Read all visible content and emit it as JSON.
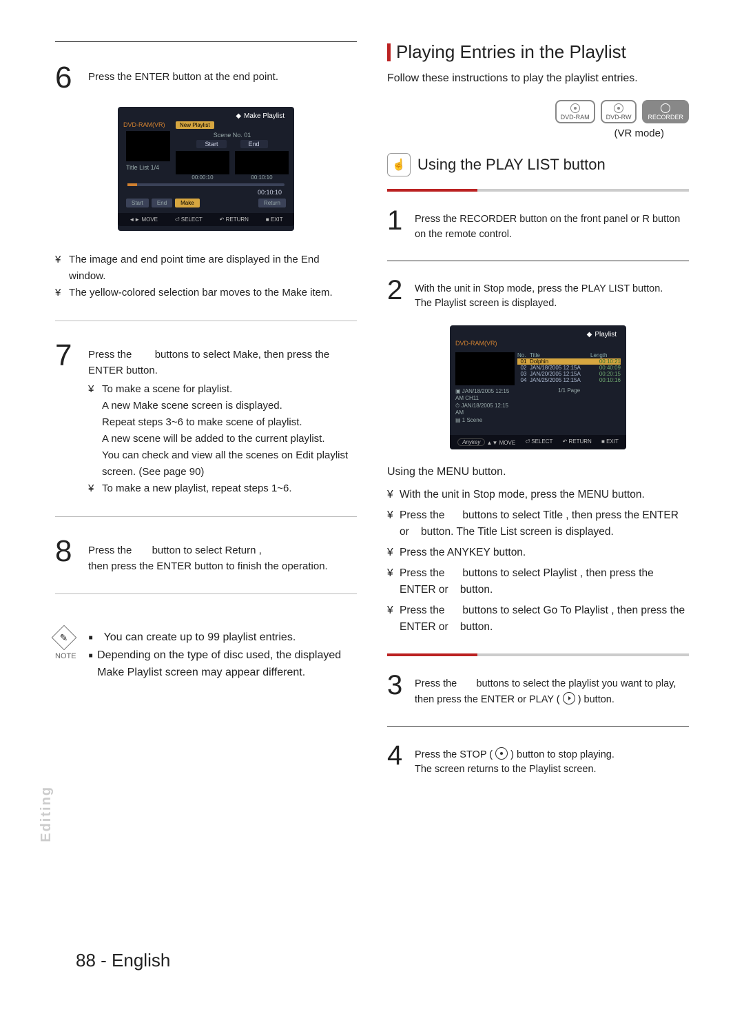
{
  "section_tab": "Editing",
  "page_footer": "88 - English",
  "left": {
    "step6": {
      "num": "6",
      "text": "Press the ENTER button at the end point."
    },
    "screenshot1": {
      "header": "Make Playlist",
      "dvd": "DVD-RAM(VR)",
      "tab": "New Playlist",
      "scene": "Scene No. 01",
      "start_lbl": "Start",
      "end_lbl": "End",
      "title_list": "Title List 1/4",
      "time1": "00:00:10",
      "time2": "00:10:10",
      "total": "00:10:10",
      "btn_start": "Start",
      "btn_end": "End",
      "btn_make": "Make",
      "btn_return": "Return",
      "foot_move": "MOVE",
      "foot_select": "SELECT",
      "foot_return": "RETURN",
      "foot_exit": "EXIT"
    },
    "after6_b1": "The image and end point time are displayed in the End window.",
    "after6_b2": "The yellow-colored selection bar moves to the Make item.",
    "step7": {
      "num": "7",
      "text_a": "Press the",
      "text_b": "buttons to select Make, then press the ENTER button.",
      "sub1": "To make a scene for playlist.",
      "sub1a": "A new Make scene screen is displayed.",
      "sub1b": "Repeat steps 3~6 to make scene of playlist.",
      "sub1c": "A new scene will be added to the current playlist.",
      "sub1d": "You can check and view all the scenes on Edit playlist screen. (See page 90)",
      "sub2": "To make a new playlist, repeat steps 1~6."
    },
    "step8": {
      "num": "8",
      "text_a": "Press the",
      "text_b": "button to select Return ,",
      "text_c": "then press the ENTER button to finish the operation."
    },
    "note": {
      "label": "NOTE",
      "l1": "You can create up to 99 playlist entries.",
      "l2": "Depending on the type of disc used, the displayed Make Playlist screen may appear different."
    }
  },
  "right": {
    "h2": "Playing Entries in the Playlist",
    "lead": "Follow these instructions to play the playlist entries.",
    "badges": {
      "a": "DVD-RAM",
      "b": "DVD-RW",
      "c": "RECORDER"
    },
    "vrmode": "(VR mode)",
    "sub_h": "Using the PLAY LIST button",
    "step1": {
      "num": "1",
      "text": "Press the RECORDER button on the front panel or R button on the remote control."
    },
    "step2": {
      "num": "2",
      "text_a": "With the unit in Stop mode, press the PLAY LIST button.",
      "text_b": "The Playlist screen is displayed."
    },
    "screenshot2": {
      "header": "Playlist",
      "dvd": "DVD-RAM(VR)",
      "th_no": "No.",
      "th_title": "Title",
      "th_len": "Length",
      "rows": [
        {
          "n": "01",
          "t": "Dolphin",
          "l": "00:10:21"
        },
        {
          "n": "02",
          "t": "JAN/18/2005 12:15A",
          "l": "00:40:09"
        },
        {
          "n": "03",
          "t": "JAN/20/2005 12:15A",
          "l": "00:20:15"
        },
        {
          "n": "04",
          "t": "JAN/25/2005 12:15A",
          "l": "00:10:16"
        }
      ],
      "info1": "JAN/18/2005 12:15 AM CH11",
      "info2": "JAN/18/2005 12:15 AM",
      "info3": "1 Scene",
      "page": "1/1  Page",
      "foot_move": "MOVE",
      "foot_select": "SELECT",
      "foot_return": "RETURN",
      "foot_exit": "EXIT"
    },
    "menu_label": "Using the MENU button.",
    "mb1": "With the unit in Stop mode, press the MENU button.",
    "mb2a": "Press the",
    "mb2b": "buttons to select Title , then press the ENTER or",
    "mb2c": "button. The Title List screen is displayed.",
    "mb3": "Press the ANYKEY button.",
    "mb4a": "Press the",
    "mb4b": "buttons to select Playlist , then press the ENTER or",
    "mb4c": "button.",
    "mb5a": "Press the",
    "mb5b": "buttons to select Go To Playlist , then press the ENTER or",
    "mb5c": "button.",
    "step3": {
      "num": "3",
      "text_a": "Press the",
      "text_b": "buttons to select the playlist you want to play, then press the ENTER or PLAY (",
      "text_c": ") button."
    },
    "step4": {
      "num": "4",
      "text_a": "Press the STOP (",
      "text_b": ")  button to stop playing.",
      "text_c": "The screen returns to the Playlist screen."
    }
  }
}
